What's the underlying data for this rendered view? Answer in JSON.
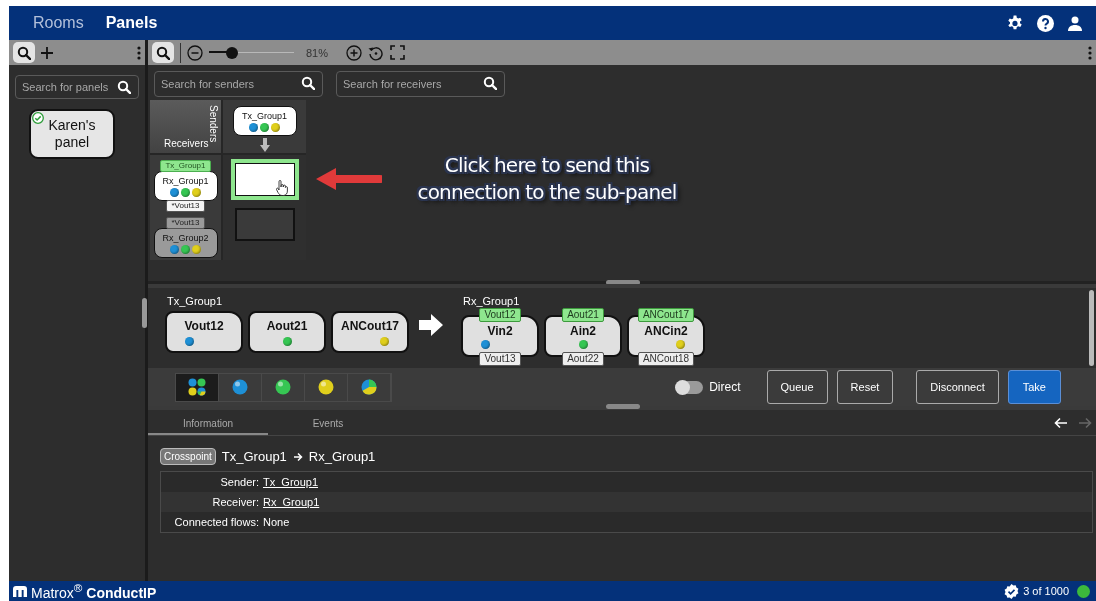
{
  "nav": {
    "tabs": [
      {
        "label": "Rooms",
        "selected": false
      },
      {
        "label": "Panels",
        "selected": true
      }
    ]
  },
  "panel_search": {
    "placeholder": "Search for panels"
  },
  "panels": [
    {
      "label": "Karen's panel",
      "checked": true
    }
  ],
  "zoom": {
    "level": 0.27,
    "reading": "81%"
  },
  "sender_search": {
    "placeholder": "Search for senders"
  },
  "receiver_search": {
    "placeholder": "Search for receivers"
  },
  "matrix": {
    "receivers_label": "Receivers",
    "senders_label": "Senders",
    "senders": [
      {
        "name": "Tx_Group1",
        "flows": [
          {
            "color": "#1e90d6"
          },
          {
            "color": "#36c653"
          },
          {
            "color": "#e0cf1c"
          }
        ]
      }
    ],
    "receivers": [
      {
        "name": "Rx_Group1",
        "selected": true,
        "source_tag": "Tx_Group1",
        "flow_tag": "*Vout13",
        "flows": [
          {
            "color": "#1e90d6"
          },
          {
            "color": "#36c653"
          },
          {
            "color": "#e0cf1c"
          }
        ]
      },
      {
        "name": "Rx_Group2",
        "selected": false,
        "flow_tag": "*Vout13",
        "flows": [
          {
            "color": "#1e90d6"
          },
          {
            "color": "#36c653"
          },
          {
            "color": "#e0cf1c"
          }
        ]
      }
    ],
    "cells": [
      {
        "selected": true
      },
      {
        "selected": false
      }
    ]
  },
  "callout": "Click here to send this connection to the sub-panel",
  "sender_group": {
    "name": "Tx_Group1",
    "flows": [
      {
        "name": "Vout12",
        "color": "#1e90d6"
      },
      {
        "name": "Aout21",
        "color": "#36c653"
      },
      {
        "name": "ANCout17",
        "color": "#e0cf1c"
      }
    ]
  },
  "receiver_group": {
    "name": "Rx_Group1",
    "flows": [
      {
        "name": "Vin2",
        "color": "#1e90d6",
        "source": "Vout12",
        "previous": "Vout13"
      },
      {
        "name": "Ain2",
        "color": "#36c653",
        "source": "Aout21",
        "previous": "Aout22"
      },
      {
        "name": "ANCin2",
        "color": "#e0cf1c",
        "source": "ANCout17",
        "previous": "ANCout18"
      }
    ]
  },
  "filters": [
    {
      "kind": "all",
      "selected": true
    },
    {
      "kind": "video",
      "selected": false
    },
    {
      "kind": "audio",
      "selected": false
    },
    {
      "kind": "anc",
      "selected": false
    },
    {
      "kind": "mixed",
      "selected": false
    }
  ],
  "direct": {
    "label": "Direct",
    "on": false
  },
  "buttons": [
    {
      "label": "Queue",
      "kind": "default"
    },
    {
      "label": "Reset",
      "kind": "default"
    },
    {
      "label": "Disconnect",
      "kind": "default"
    },
    {
      "label": "Take",
      "kind": "primary"
    }
  ],
  "info_tabs": [
    {
      "label": "Information",
      "selected": true
    },
    {
      "label": "Events",
      "selected": false
    }
  ],
  "history": {
    "back_disabled": false,
    "forward_disabled": true
  },
  "crosspoint": {
    "badge": "Crosspoint",
    "sender": "Tx_Group1",
    "receiver": "Rx_Group1"
  },
  "details": [
    {
      "label": "Sender:",
      "value": "Tx_Group1",
      "kind": "link"
    },
    {
      "label": "Receiver:",
      "value": "Rx_Group1",
      "kind": "link"
    },
    {
      "label": "Connected flows:",
      "value": "None",
      "kind": "text"
    }
  ],
  "footer": {
    "brand": "Matrox$^{®}$ **ConductIP**",
    "count": "3 of 1000",
    "connected": true
  }
}
